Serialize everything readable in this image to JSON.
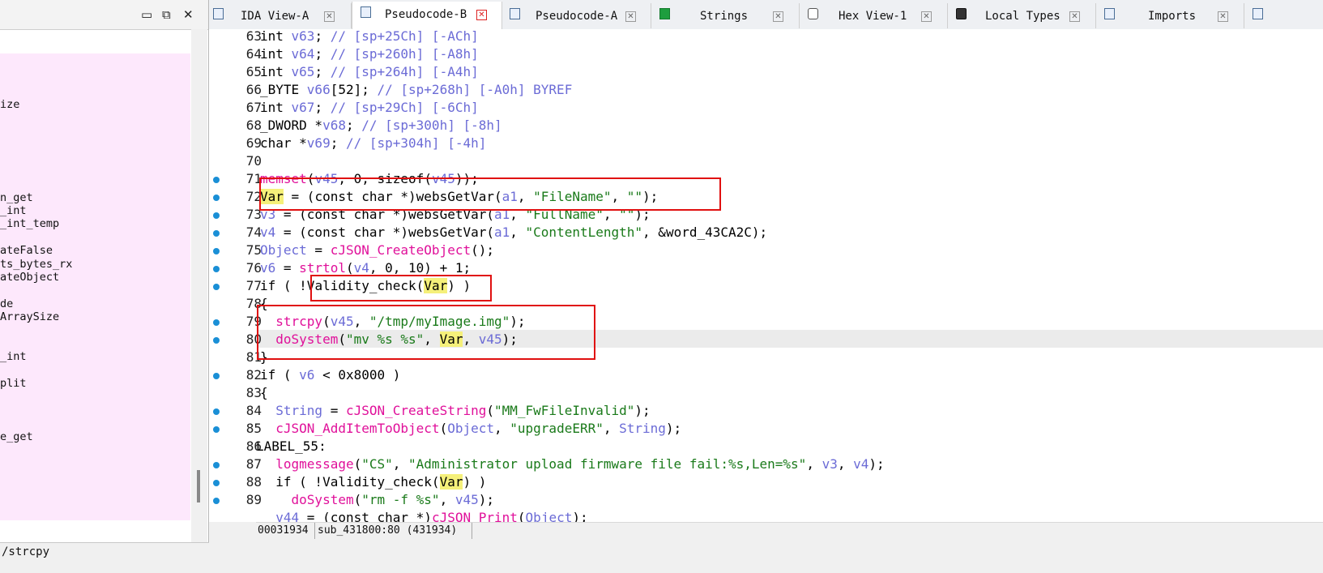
{
  "left_pane": {
    "window_buttons": [
      "▭",
      "⧉",
      "✕"
    ],
    "functions": [
      {
        "text": "ize",
        "row": 2
      },
      {
        "text": "n_get",
        "row": 9
      },
      {
        "text": "_int",
        "row": 10
      },
      {
        "text": "_int_temp",
        "row": 11
      },
      {
        "text": "ateFalse",
        "row": 13
      },
      {
        "text": "ts_bytes_rx",
        "row": 14
      },
      {
        "text": "ateObject",
        "row": 15
      },
      {
        "text": "de",
        "row": 17
      },
      {
        "text": "ArraySize",
        "row": 18
      },
      {
        "text": "_int",
        "row": 21
      },
      {
        "text": "plit",
        "row": 23
      },
      {
        "text": "e_get",
        "row": 27
      }
    ],
    "status_text": "/strcpy"
  },
  "tabs": [
    {
      "label": "IDA View-A",
      "icon": "ida-view-icon",
      "active": false
    },
    {
      "label": "Pseudocode-B",
      "icon": "pseudocode-icon",
      "active": true
    },
    {
      "label": "Pseudocode-A",
      "icon": "pseudocode-icon",
      "active": false
    },
    {
      "label": "Strings",
      "icon": "strings-icon",
      "active": false
    },
    {
      "label": "Hex View-1",
      "icon": "hex-view-icon",
      "active": false
    },
    {
      "label": "Local Types",
      "icon": "local-types-icon",
      "active": false
    },
    {
      "label": "Imports",
      "icon": "imports-icon",
      "active": false
    }
  ],
  "code_lines": [
    {
      "num": "63",
      "bp": false,
      "segs": [
        [
          "k",
          "int "
        ],
        [
          "v",
          "v63"
        ],
        [
          "k",
          "; "
        ],
        [
          "c",
          "// [sp+25Ch] [-ACh]"
        ]
      ]
    },
    {
      "num": "64",
      "bp": false,
      "segs": [
        [
          "k",
          "int "
        ],
        [
          "v",
          "v64"
        ],
        [
          "k",
          "; "
        ],
        [
          "c",
          "// [sp+260h] [-A8h]"
        ]
      ]
    },
    {
      "num": "65",
      "bp": false,
      "segs": [
        [
          "k",
          "int "
        ],
        [
          "v",
          "v65"
        ],
        [
          "k",
          "; "
        ],
        [
          "c",
          "// [sp+264h] [-A4h]"
        ]
      ]
    },
    {
      "num": "66",
      "bp": false,
      "segs": [
        [
          "k",
          "_BYTE "
        ],
        [
          "v",
          "v66"
        ],
        [
          "k",
          "[52]; "
        ],
        [
          "c",
          "// [sp+268h] [-A0h] BYREF"
        ]
      ]
    },
    {
      "num": "67",
      "bp": false,
      "segs": [
        [
          "k",
          "int "
        ],
        [
          "v",
          "v67"
        ],
        [
          "k",
          "; "
        ],
        [
          "c",
          "// [sp+29Ch] [-6Ch]"
        ]
      ]
    },
    {
      "num": "68",
      "bp": false,
      "segs": [
        [
          "k",
          "_DWORD *"
        ],
        [
          "v",
          "v68"
        ],
        [
          "k",
          "; "
        ],
        [
          "c",
          "// [sp+300h] [-8h]"
        ]
      ]
    },
    {
      "num": "69",
      "bp": false,
      "segs": [
        [
          "k",
          "char *"
        ],
        [
          "v",
          "v69"
        ],
        [
          "k",
          "; "
        ],
        [
          "c",
          "// [sp+304h] [-4h]"
        ]
      ]
    },
    {
      "num": "70",
      "bp": false,
      "segs": []
    },
    {
      "num": "71",
      "bp": true,
      "segs": [
        [
          "f",
          "memset"
        ],
        [
          "k",
          "("
        ],
        [
          "v",
          "v45"
        ],
        [
          "k",
          ", 0, "
        ],
        [
          "b",
          "sizeof"
        ],
        [
          "k",
          "("
        ],
        [
          "v",
          "v45"
        ],
        [
          "k",
          "));"
        ]
      ]
    },
    {
      "num": "72",
      "bp": true,
      "segs": [
        [
          "h",
          "Var"
        ],
        [
          "k",
          " = (const char *)"
        ],
        [
          "b",
          "websGetVar"
        ],
        [
          "k",
          "("
        ],
        [
          "v",
          "a1"
        ],
        [
          "k",
          ", "
        ],
        [
          "s",
          "\"FileName\""
        ],
        [
          "k",
          ", "
        ],
        [
          "s",
          "\"\""
        ],
        [
          "k",
          ");"
        ]
      ]
    },
    {
      "num": "73",
      "bp": true,
      "segs": [
        [
          "v",
          "v3"
        ],
        [
          "k",
          " = (const char *)"
        ],
        [
          "b",
          "websGetVar"
        ],
        [
          "k",
          "("
        ],
        [
          "v",
          "a1"
        ],
        [
          "k",
          ", "
        ],
        [
          "s",
          "\"FullName\""
        ],
        [
          "k",
          ", "
        ],
        [
          "s",
          "\"\""
        ],
        [
          "k",
          ");"
        ]
      ]
    },
    {
      "num": "74",
      "bp": true,
      "segs": [
        [
          "v",
          "v4"
        ],
        [
          "k",
          " = (const char *)"
        ],
        [
          "b",
          "websGetVar"
        ],
        [
          "k",
          "("
        ],
        [
          "v",
          "a1"
        ],
        [
          "k",
          ", "
        ],
        [
          "s",
          "\"ContentLength\""
        ],
        [
          "k",
          ", &"
        ],
        [
          "b",
          "word_43CA2C"
        ],
        [
          "k",
          ");"
        ]
      ]
    },
    {
      "num": "75",
      "bp": true,
      "segs": [
        [
          "v",
          "Object"
        ],
        [
          "k",
          " = "
        ],
        [
          "f",
          "cJSON_CreateObject"
        ],
        [
          "k",
          "();"
        ]
      ]
    },
    {
      "num": "76",
      "bp": true,
      "segs": [
        [
          "v",
          "v6"
        ],
        [
          "k",
          " = "
        ],
        [
          "f",
          "strtol"
        ],
        [
          "k",
          "("
        ],
        [
          "v",
          "v4"
        ],
        [
          "k",
          ", 0, 10) + 1;"
        ]
      ]
    },
    {
      "num": "77",
      "bp": true,
      "segs": [
        [
          "k",
          "if ( "
        ],
        [
          "b",
          "!Validity_check"
        ],
        [
          "k",
          "("
        ],
        [
          "h",
          "Var"
        ],
        [
          "k",
          ") )"
        ]
      ]
    },
    {
      "num": "78",
      "bp": false,
      "segs": [
        [
          "k",
          "{"
        ]
      ]
    },
    {
      "num": "79",
      "bp": true,
      "segs": [
        [
          "k",
          "  "
        ],
        [
          "f",
          "strcpy"
        ],
        [
          "k",
          "("
        ],
        [
          "v",
          "v45"
        ],
        [
          "k",
          ", "
        ],
        [
          "s",
          "\"/tmp/myImage.img\""
        ],
        [
          "k",
          ");"
        ]
      ]
    },
    {
      "num": "80",
      "bp": true,
      "segs": [
        [
          "k",
          "  "
        ],
        [
          "f",
          "doSystem"
        ],
        [
          "k",
          "("
        ],
        [
          "s",
          "\"mv %s %s\""
        ],
        [
          "k",
          ", "
        ],
        [
          "h",
          "Var"
        ],
        [
          "k",
          ", "
        ],
        [
          "v",
          "v45"
        ],
        [
          "k",
          ");"
        ]
      ]
    },
    {
      "num": "81",
      "bp": false,
      "segs": [
        [
          "k",
          "}"
        ]
      ]
    },
    {
      "num": "82",
      "bp": true,
      "segs": [
        [
          "k",
          "if ( "
        ],
        [
          "v",
          "v6"
        ],
        [
          "k",
          " < 0x8000 )"
        ]
      ]
    },
    {
      "num": "83",
      "bp": false,
      "segs": [
        [
          "k",
          "{"
        ]
      ]
    },
    {
      "num": "84",
      "bp": true,
      "segs": [
        [
          "k",
          "  "
        ],
        [
          "v",
          "String"
        ],
        [
          "k",
          " = "
        ],
        [
          "f",
          "cJSON_CreateString"
        ],
        [
          "k",
          "("
        ],
        [
          "s",
          "\"MM_FwFileInvalid\""
        ],
        [
          "k",
          ");"
        ]
      ]
    },
    {
      "num": "85",
      "bp": true,
      "segs": [
        [
          "k",
          "  "
        ],
        [
          "f",
          "cJSON_AddItemToObject"
        ],
        [
          "k",
          "("
        ],
        [
          "v",
          "Object"
        ],
        [
          "k",
          ", "
        ],
        [
          "s",
          "\"upgradeERR\""
        ],
        [
          "k",
          ", "
        ],
        [
          "v",
          "String"
        ],
        [
          "k",
          ");"
        ]
      ]
    },
    {
      "num": "86",
      "bp": false,
      "segs": [
        [
          "L",
          "LABEL_55:"
        ]
      ]
    },
    {
      "num": "87",
      "bp": true,
      "segs": [
        [
          "k",
          "  "
        ],
        [
          "f",
          "logmessage"
        ],
        [
          "k",
          "("
        ],
        [
          "s",
          "\"CS\""
        ],
        [
          "k",
          ", "
        ],
        [
          "s",
          "\"Administrator upload firmware file fail:%s,Len=%s\""
        ],
        [
          "k",
          ", "
        ],
        [
          "v",
          "v3"
        ],
        [
          "k",
          ", "
        ],
        [
          "v",
          "v4"
        ],
        [
          "k",
          ");"
        ]
      ]
    },
    {
      "num": "88",
      "bp": true,
      "segs": [
        [
          "k",
          "  if ( !"
        ],
        [
          "b",
          "Validity_check"
        ],
        [
          "k",
          "("
        ],
        [
          "h",
          "Var"
        ],
        [
          "k",
          ") )"
        ]
      ]
    },
    {
      "num": "89",
      "bp": true,
      "segs": [
        [
          "k",
          "    "
        ],
        [
          "f",
          "doSystem"
        ],
        [
          "k",
          "("
        ],
        [
          "s",
          "\"rm -f %s\""
        ],
        [
          "k",
          ", "
        ],
        [
          "v",
          "v45"
        ],
        [
          "k",
          ");"
        ]
      ]
    },
    {
      "num": "",
      "bp": false,
      "segs": [
        [
          "k",
          "  "
        ],
        [
          "v",
          "v44"
        ],
        [
          "k",
          " = (const char *)"
        ],
        [
          "f",
          "cJSON_Print"
        ],
        [
          "k",
          "("
        ],
        [
          "v",
          "Object"
        ],
        [
          "k",
          ");"
        ]
      ]
    }
  ],
  "status": {
    "address": "00031934",
    "location": "sub_431800:80 (431934)"
  },
  "colors": {
    "breakpoint_dot": "#1a8fd6",
    "function": "#e0109a",
    "variable": "#6b6bd6",
    "string": "#1a7a1a",
    "highlight": "#f5f07a",
    "annotation_box": "#e01010"
  }
}
